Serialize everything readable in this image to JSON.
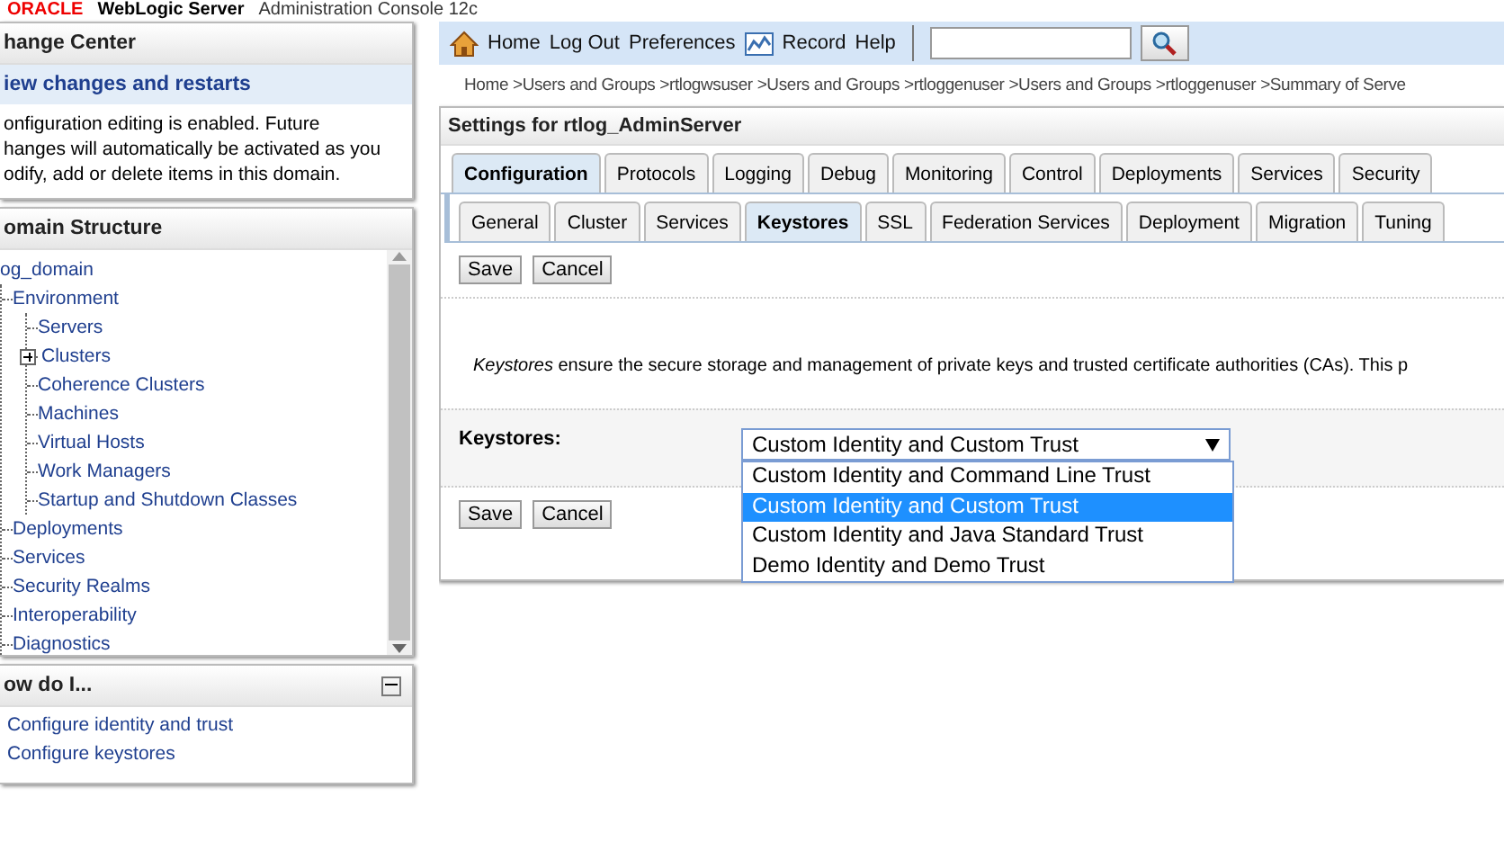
{
  "header": {
    "logo": "ORACLE",
    "product": "WebLogic Server",
    "subtitle": "Administration Console 12c"
  },
  "change_center": {
    "title": "hange Center",
    "link": "iew changes and restarts",
    "lines": [
      "onfiguration editing is enabled. Future",
      "hanges will automatically be activated as you",
      "odify, add or delete items in this domain."
    ]
  },
  "domain_structure": {
    "title": "omain Structure",
    "tree": [
      {
        "label": "og_domain",
        "children": [
          {
            "label": "Environment",
            "children": [
              {
                "label": "Servers"
              },
              {
                "label": "Clusters",
                "expanded": false
              },
              {
                "label": "Coherence Clusters"
              },
              {
                "label": "Machines"
              },
              {
                "label": "Virtual Hosts"
              },
              {
                "label": "Work Managers"
              },
              {
                "label": "Startup and Shutdown Classes"
              }
            ]
          },
          {
            "label": "Deployments"
          },
          {
            "label": "Services"
          },
          {
            "label": "Security Realms"
          },
          {
            "label": "Interoperability"
          },
          {
            "label": "Diagnostics"
          }
        ]
      }
    ]
  },
  "how_do_i": {
    "title": "ow do I...",
    "links": [
      "Configure identity and trust",
      "Configure keystores"
    ]
  },
  "toolbar": {
    "links": [
      "Home",
      "Log Out",
      "Preferences",
      "Record",
      "Help"
    ]
  },
  "breadcrumb": "Home >Users and Groups >rtlogwsuser >Users and Groups >rtloggenuser >Users and Groups >rtloggenuser >Summary of Serve",
  "settings": {
    "title": "Settings for rtlog_AdminServer",
    "tabs": [
      {
        "label": "Configuration",
        "selected": true
      },
      {
        "label": "Protocols",
        "selected": false
      },
      {
        "label": "Logging",
        "selected": false
      },
      {
        "label": "Debug",
        "selected": false
      },
      {
        "label": "Monitoring",
        "selected": false
      },
      {
        "label": "Control",
        "selected": false
      },
      {
        "label": "Deployments",
        "selected": false
      },
      {
        "label": "Services",
        "selected": false
      },
      {
        "label": "Security",
        "selected": false
      }
    ],
    "subtabs": [
      {
        "label": "General",
        "selected": false
      },
      {
        "label": "Cluster",
        "selected": false
      },
      {
        "label": "Services",
        "selected": false
      },
      {
        "label": "Keystores",
        "selected": true
      },
      {
        "label": "SSL",
        "selected": false
      },
      {
        "label": "Federation Services",
        "selected": false
      },
      {
        "label": "Deployment",
        "selected": false
      },
      {
        "label": "Migration",
        "selected": false
      },
      {
        "label": "Tuning",
        "selected": false
      }
    ],
    "buttons": [
      "Save",
      "Cancel"
    ],
    "description": "*Keystores* ensure the secure storage and management of private keys and trusted certificate authorities (CAs). This p",
    "field_label": "Keystores:",
    "dropdown": {
      "value": "Custom Identity and Custom Trust",
      "options": [
        {
          "label": "Custom Identity and Command Line Trust",
          "selected": false
        },
        {
          "label": "Custom Identity and Custom Trust",
          "selected": true
        },
        {
          "label": "Custom Identity and Java Standard Trust",
          "selected": false
        },
        {
          "label": "Demo Identity and Demo Trust",
          "selected": false
        }
      ]
    },
    "bottom_buttons": [
      "Save",
      "Cancel"
    ]
  }
}
